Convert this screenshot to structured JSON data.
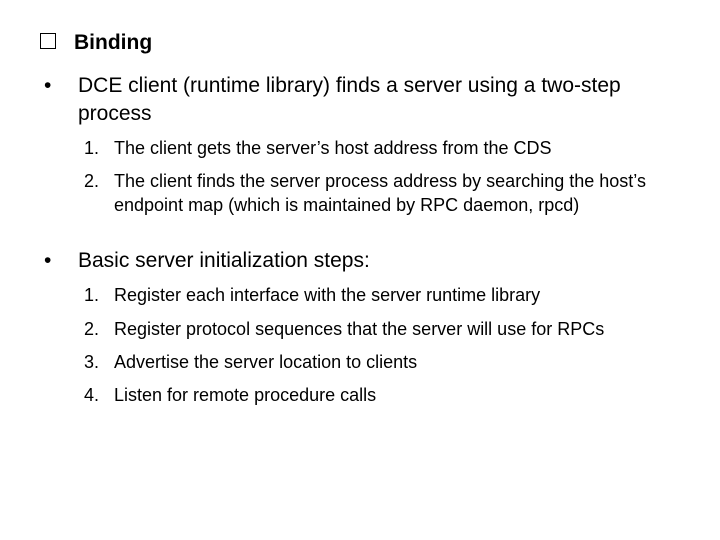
{
  "heading": "Binding",
  "section1": {
    "text": "DCE client (runtime library) finds a server using a two-step process",
    "items": [
      {
        "num": "1.",
        "text": "The client gets the server’s host address from the CDS"
      },
      {
        "num": "2.",
        "text": "The client finds the server process address by searching the host’s endpoint map (which is maintained by RPC daemon, rpcd)"
      }
    ]
  },
  "section2": {
    "text": "Basic server initialization steps:",
    "items": [
      {
        "num": "1.",
        "text": "Register each interface with the server runtime library"
      },
      {
        "num": "2.",
        "text": "Register protocol sequences that the server will use for RPCs"
      },
      {
        "num": "3.",
        "text": "Advertise the server location to clients"
      },
      {
        "num": "4.",
        "text": "Listen for remote procedure calls"
      }
    ]
  }
}
